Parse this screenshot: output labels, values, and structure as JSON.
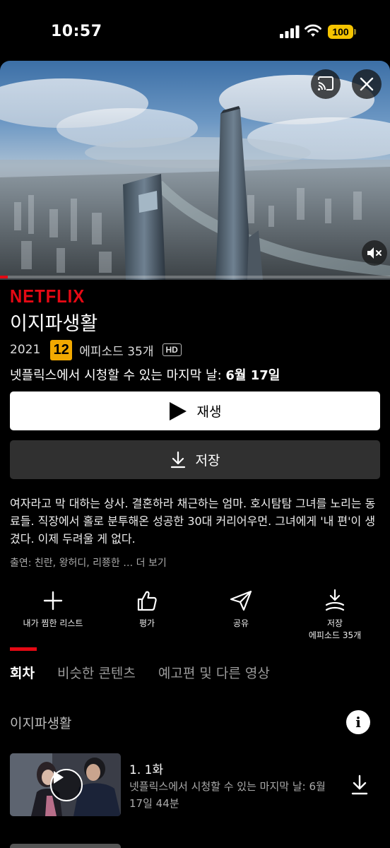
{
  "status_bar": {
    "time": "10:57",
    "battery": "100"
  },
  "hero": {
    "progress": 0.02
  },
  "brand": "NETFLIX",
  "title": "이지파생활",
  "meta": {
    "year": "2021",
    "rating": "12",
    "episodes": "에피소드 35개",
    "quality": "HD"
  },
  "last_day": {
    "prefix": "넷플릭스에서 시청할 수 있는 마지막 날: ",
    "date": "6월 17일"
  },
  "buttons": {
    "play": "재생",
    "save": "저장"
  },
  "description": "여자라고 막 대하는 상사. 결혼하라 채근하는 엄마. 호시탐탐 그녀를 노리는 동료들. 직장에서 홀로 분투해온 성공한 30대 커리어우먼. 그녀에게 '내 편'이 생겼다. 이제 두려울 게 없다.",
  "cast": "출연: 친란, 왕허디, 리쭁한 … 더 보기",
  "actions": {
    "my_list": "내가 찜한 리스트",
    "rate": "평가",
    "share": "공유",
    "download_line1": "저장",
    "download_line2": "에피소드 35개"
  },
  "tabs": [
    "회차",
    "비슷한 콘텐츠",
    "예고편 및 다른 영상"
  ],
  "season": "이지파생활",
  "episode": {
    "title": "1. 1화",
    "subtitle": "넷플릭스에서 시청할 수 있는 마지막 날: 6월 17일  44분"
  },
  "colors": {
    "accent": "#e50914",
    "rating_badge": "#f2a900",
    "battery": "#f5c400"
  }
}
